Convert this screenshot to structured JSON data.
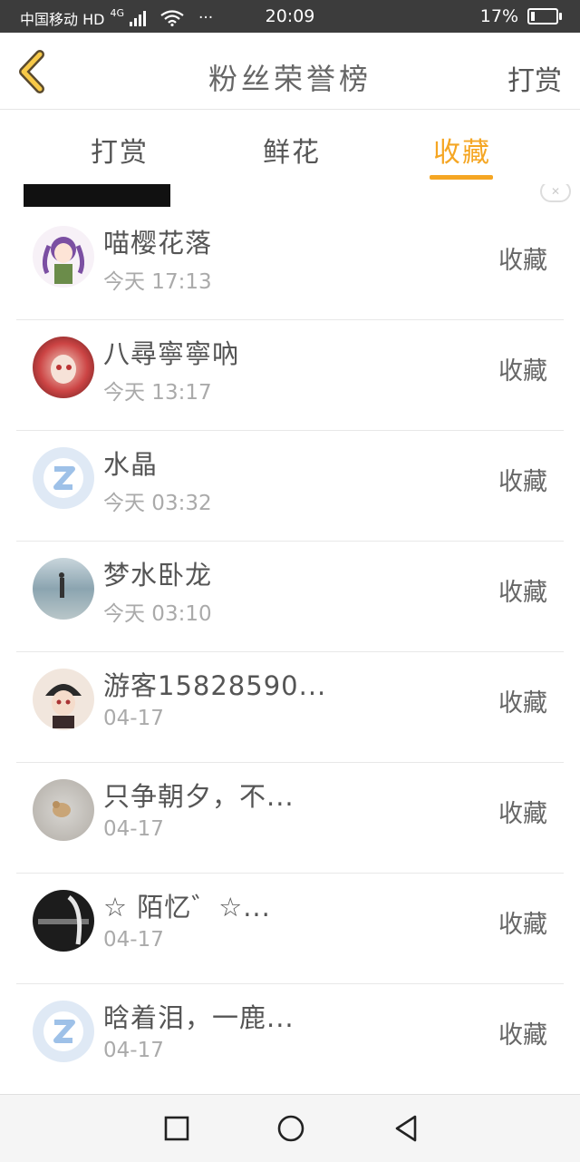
{
  "status_bar": {
    "carrier": "中国移动 HD",
    "network": "4G",
    "more": "···",
    "time": "20:09",
    "battery": "17%",
    "battery_level": 0.17
  },
  "header": {
    "title": "粉丝荣誉榜",
    "right_action": "打赏"
  },
  "tabs": [
    {
      "label": "打赏",
      "active": false
    },
    {
      "label": "鲜花",
      "active": false
    },
    {
      "label": "收藏",
      "active": true
    }
  ],
  "accent_color": "#f5a623",
  "list": [
    {
      "name": "喵樱花落",
      "time": "今天 17:13",
      "action": "收藏",
      "avatar": "anime-girl"
    },
    {
      "name": "八尋寧寧吶",
      "time": "今天 13:17",
      "action": "收藏",
      "avatar": "anime-girl-dark"
    },
    {
      "name": "水晶",
      "time": "今天 03:32",
      "action": "收藏",
      "avatar": "default"
    },
    {
      "name": "梦水卧龙",
      "time": "今天 03:10",
      "action": "收藏",
      "avatar": "beach-photo"
    },
    {
      "name": "游客15828590...",
      "time": "04-17",
      "action": "收藏",
      "avatar": "anime-boy"
    },
    {
      "name": "只争朝夕，不...",
      "time": "04-17",
      "action": "收藏",
      "avatar": "pet-photo"
    },
    {
      "name": "☆ 陌忆゛☆...",
      "time": "04-17",
      "action": "收藏",
      "avatar": "dark-photo"
    },
    {
      "name": "晗着泪，一鹿...",
      "time": "04-17",
      "action": "收藏",
      "avatar": "default"
    }
  ]
}
